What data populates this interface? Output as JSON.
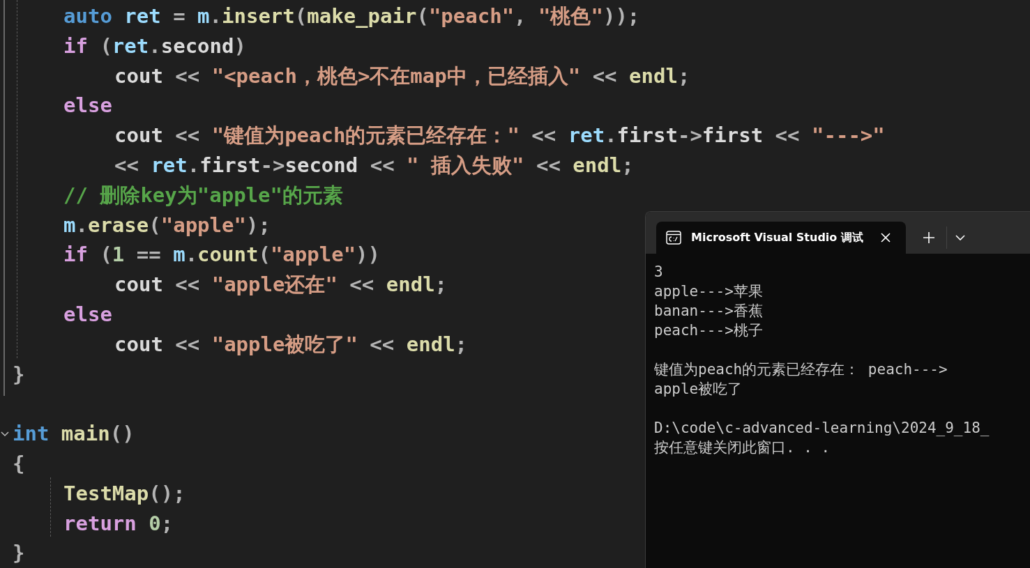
{
  "code": {
    "lines": [
      {
        "children": [
          {
            "tokens": [
              {
                "kind": "keyword",
                "text": "auto "
              },
              {
                "kind": "variable",
                "text": "ret"
              },
              {
                "kind": "operator",
                "text": " = "
              },
              {
                "kind": "variable",
                "text": "m"
              },
              {
                "kind": "operator",
                "text": "."
              },
              {
                "kind": "function",
                "text": "insert"
              },
              {
                "kind": "operator",
                "text": "("
              },
              {
                "kind": "function",
                "text": "make_pair"
              },
              {
                "kind": "operator",
                "text": "("
              },
              {
                "kind": "string",
                "text": "\"peach\""
              },
              {
                "kind": "operator",
                "text": ", "
              },
              {
                "kind": "string",
                "text": "\"桃色\""
              },
              {
                "kind": "operator",
                "text": "));"
              }
            ]
          },
          {
            "tokens": [
              {
                "kind": "control",
                "text": "if "
              },
              {
                "kind": "operator",
                "text": "("
              },
              {
                "kind": "variable",
                "text": "ret"
              },
              {
                "kind": "operator",
                "text": "."
              },
              {
                "kind": "member",
                "text": "second"
              },
              {
                "kind": "operator",
                "text": ")"
              }
            ],
            "children": [
              {
                "tokens": [
                  {
                    "kind": "member",
                    "text": "cout"
                  },
                  {
                    "kind": "operator",
                    "text": " << "
                  },
                  {
                    "kind": "string",
                    "text": "\"<peach，桃色>不在map中，已经插入\""
                  },
                  {
                    "kind": "operator",
                    "text": " << "
                  },
                  {
                    "kind": "function",
                    "text": "endl"
                  },
                  {
                    "kind": "operator",
                    "text": ";"
                  }
                ]
              }
            ]
          },
          {
            "tokens": [
              {
                "kind": "control",
                "text": "else"
              }
            ],
            "children": [
              {
                "tokens": [
                  {
                    "kind": "member",
                    "text": "cout"
                  },
                  {
                    "kind": "operator",
                    "text": " << "
                  },
                  {
                    "kind": "string",
                    "text": "\"键值为peach的元素已经存在：\""
                  },
                  {
                    "kind": "operator",
                    "text": " << "
                  },
                  {
                    "kind": "variable",
                    "text": "ret"
                  },
                  {
                    "kind": "operator",
                    "text": "."
                  },
                  {
                    "kind": "member",
                    "text": "first"
                  },
                  {
                    "kind": "operator",
                    "text": "->"
                  },
                  {
                    "kind": "member",
                    "text": "first"
                  },
                  {
                    "kind": "operator",
                    "text": " << "
                  },
                  {
                    "kind": "string",
                    "text": "\"--->\""
                  }
                ]
              },
              {
                "tokens": [
                  {
                    "kind": "operator",
                    "text": "<< "
                  },
                  {
                    "kind": "variable",
                    "text": "ret"
                  },
                  {
                    "kind": "operator",
                    "text": "."
                  },
                  {
                    "kind": "member",
                    "text": "first"
                  },
                  {
                    "kind": "operator",
                    "text": "->"
                  },
                  {
                    "kind": "member",
                    "text": "second"
                  },
                  {
                    "kind": "operator",
                    "text": " << "
                  },
                  {
                    "kind": "string",
                    "text": "\" 插入失败\""
                  },
                  {
                    "kind": "operator",
                    "text": " << "
                  },
                  {
                    "kind": "function",
                    "text": "endl"
                  },
                  {
                    "kind": "operator",
                    "text": ";"
                  }
                ]
              }
            ]
          },
          {
            "tokens": [
              {
                "kind": "comment",
                "text": "// 删除key为\"apple\"的元素"
              }
            ]
          },
          {
            "tokens": [
              {
                "kind": "variable",
                "text": "m"
              },
              {
                "kind": "operator",
                "text": "."
              },
              {
                "kind": "function",
                "text": "erase"
              },
              {
                "kind": "operator",
                "text": "("
              },
              {
                "kind": "string",
                "text": "\"apple\""
              },
              {
                "kind": "operator",
                "text": ");"
              }
            ]
          },
          {
            "tokens": [
              {
                "kind": "control",
                "text": "if "
              },
              {
                "kind": "operator",
                "text": "("
              },
              {
                "kind": "number",
                "text": "1"
              },
              {
                "kind": "operator",
                "text": " == "
              },
              {
                "kind": "variable",
                "text": "m"
              },
              {
                "kind": "operator",
                "text": "."
              },
              {
                "kind": "function",
                "text": "count"
              },
              {
                "kind": "operator",
                "text": "("
              },
              {
                "kind": "string",
                "text": "\"apple\""
              },
              {
                "kind": "operator",
                "text": "))"
              }
            ],
            "children": [
              {
                "tokens": [
                  {
                    "kind": "member",
                    "text": "cout"
                  },
                  {
                    "kind": "operator",
                    "text": " << "
                  },
                  {
                    "kind": "string",
                    "text": "\"apple还在\""
                  },
                  {
                    "kind": "operator",
                    "text": " << "
                  },
                  {
                    "kind": "function",
                    "text": "endl"
                  },
                  {
                    "kind": "operator",
                    "text": ";"
                  }
                ]
              }
            ]
          },
          {
            "tokens": [
              {
                "kind": "control",
                "text": "else"
              }
            ],
            "children": [
              {
                "tokens": [
                  {
                    "kind": "member",
                    "text": "cout"
                  },
                  {
                    "kind": "operator",
                    "text": " << "
                  },
                  {
                    "kind": "string",
                    "text": "\"apple被吃了\""
                  },
                  {
                    "kind": "operator",
                    "text": " << "
                  },
                  {
                    "kind": "function",
                    "text": "endl"
                  },
                  {
                    "kind": "operator",
                    "text": ";"
                  }
                ]
              }
            ]
          }
        ]
      },
      {
        "tokens": [
          {
            "kind": "operator",
            "text": "}"
          }
        ]
      },
      {
        "kind": "blank"
      },
      {
        "tokens": [
          {
            "kind": "keyword",
            "text": "int "
          },
          {
            "kind": "function",
            "text": "main"
          },
          {
            "kind": "operator",
            "text": "()"
          }
        ],
        "expanded": true
      },
      {
        "tokens": [
          {
            "kind": "operator",
            "text": "{"
          }
        ],
        "children": [
          {
            "tokens": [
              {
                "kind": "function",
                "text": "TestMap"
              },
              {
                "kind": "operator",
                "text": "();"
              }
            ]
          },
          {
            "tokens": [
              {
                "kind": "control",
                "text": "return "
              },
              {
                "kind": "number",
                "text": "0"
              },
              {
                "kind": "operator",
                "text": ";"
              }
            ]
          }
        ]
      },
      {
        "tokens": [
          {
            "kind": "operator",
            "text": "}"
          }
        ]
      }
    ]
  },
  "terminal": {
    "tab": {
      "title": "Microsoft Visual Studio 调试",
      "selected": true
    },
    "output_blocks": [
      [
        "3",
        "apple--->苹果",
        "banan--->香蕉",
        "peach--->桃子"
      ],
      [
        "键值为peach的元素已经存在： peach--->",
        "apple被吃了"
      ],
      [
        "D:\\code\\c-advanced-learning\\2024_9_18_",
        "按任意键关闭此窗口. . ."
      ]
    ]
  }
}
